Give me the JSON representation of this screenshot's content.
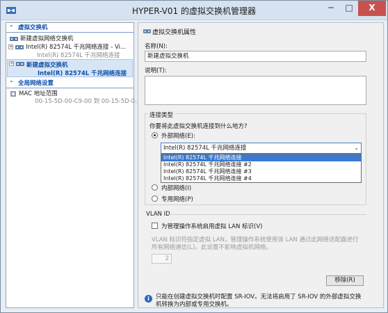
{
  "window": {
    "title": "HYPER-V01 的虚拟交换机管理器",
    "buttons": {
      "minimize": "─",
      "maximize": "□",
      "close": "X"
    }
  },
  "sidebar": {
    "virtual_switches_header": "虚拟交换机",
    "new_switch_item": "新建虚拟网络交换机",
    "existing_switch": {
      "name": "Intel(R) 82574L 千兆网络连接 - Vi...",
      "sub": "Intel(R) 82574L 千兆网络连接"
    },
    "new_switch_selected": {
      "name": "新建虚拟交换机",
      "sub": "Intel(R) 82574L 千兆网络连接"
    },
    "global_header": "全局网络设置",
    "mac_range": {
      "label": "MAC 地址范围",
      "value": "00-15-5D-00-C9-00 到 00-15-5D-0..."
    }
  },
  "properties": {
    "title": "虚拟交换机属性",
    "name_label": "名称(N):",
    "name_value": "新建虚拟交换机",
    "notes_label": "说明(T):",
    "notes_value": ""
  },
  "connection": {
    "group_label": "连接类型",
    "question": "你要将此虚拟交换机连接到什么地方?",
    "external_label": "外部网络(E):",
    "selected_adapter": "Intel(R) 82574L 千兆网络连接",
    "adapter_options": [
      "Intel(R) 82574L 千兆网络连接",
      "Intel(R) 82574L 千兆网络连接 #2",
      "Intel(R) 82574L 千兆网络连接 #3",
      "Intel(R) 82574L 千兆网络连接 #4"
    ],
    "internal_label": "内部网络(I)",
    "private_label": "专用网络(P)",
    "selected_type": "external"
  },
  "vlan": {
    "header": "VLAN ID",
    "checkbox_label": "为管理操作系统启用虚拟 LAN 标识(V)",
    "description_line1": "VLAN 标识符指定虚拟 LAN，管理操作系统使用该 LAN 通过此网络适配器进行",
    "description_line2": "所有网络通信(L)。此设置不影响虚拟机网络。",
    "id_value": "2"
  },
  "actions": {
    "remove_label": "移除(R)"
  },
  "info": {
    "text": "只能在创建虚拟交换机时配置 SR-IOV。无法将启用了 SR-IOV 的外部虚拟交换机转换为内部或专用交换机。"
  },
  "colors": {
    "accent": "#0b4fa8",
    "selection": "#3a79cf",
    "close": "#c7524d"
  },
  "icons": {
    "app": "hyperv-switch-icon",
    "section_collapse": "chevron-up-icon",
    "switch": "network-switch-icon",
    "info": "info-icon"
  }
}
